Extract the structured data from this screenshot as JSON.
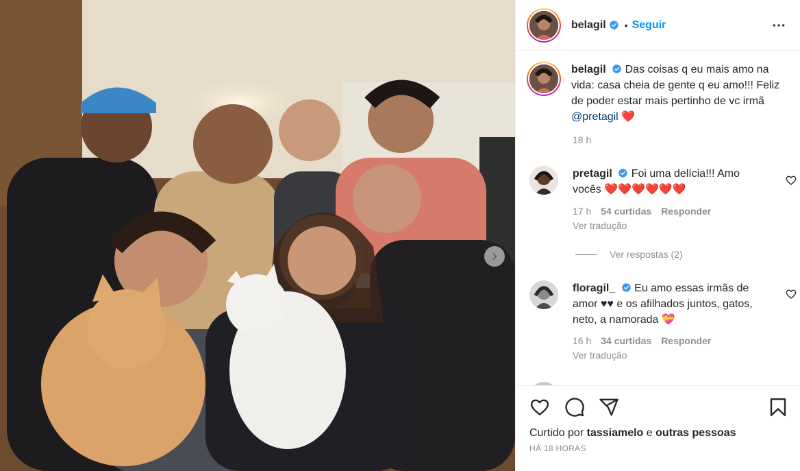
{
  "post": {
    "author": "belagil",
    "follow_label": "Seguir",
    "separator": "•",
    "caption_text": "Das coisas q eu mais amo na vida: casa cheia de gente q eu amo!!! Feliz de poder estar mais pertinho de vc irmã",
    "caption_mention": "@pretagil",
    "caption_emoji": "❤️",
    "caption_time": "18 h"
  },
  "comments": [
    {
      "username": "pretagil",
      "text": "Foi uma delícia!!! Amo vocês ❤️❤️❤️❤️❤️❤️",
      "time": "17 h",
      "likes": "54 curtidas",
      "reply": "Responder",
      "translate": "Ver tradução"
    },
    {
      "username": "floragil_",
      "text": "Eu amo essas irmãs de amor ♥♥ e os afilhados juntos, gatos, neto, a namorada 💝",
      "time": "16 h",
      "likes": "34 curtidas",
      "reply": "Responder",
      "translate": "Ver tradução"
    }
  ],
  "view_replies": "Ver respostas (2)",
  "footer": {
    "liked_prefix": "Curtido por",
    "liked_user": "tassiamelo",
    "liked_conj": "e",
    "liked_others": "outras pessoas",
    "posted_ago": "HÁ 18 HORAS"
  },
  "icons": {
    "verified": "verified-badge-icon",
    "more": "more-options-icon",
    "like": "heart-icon",
    "comment": "comment-icon",
    "share": "share-icon",
    "save": "bookmark-icon",
    "next": "chevron-right-icon"
  },
  "colors": {
    "link": "#0095f6",
    "verified": "#3897f0",
    "mention": "#00376b",
    "muted": "#8e8e8e"
  }
}
